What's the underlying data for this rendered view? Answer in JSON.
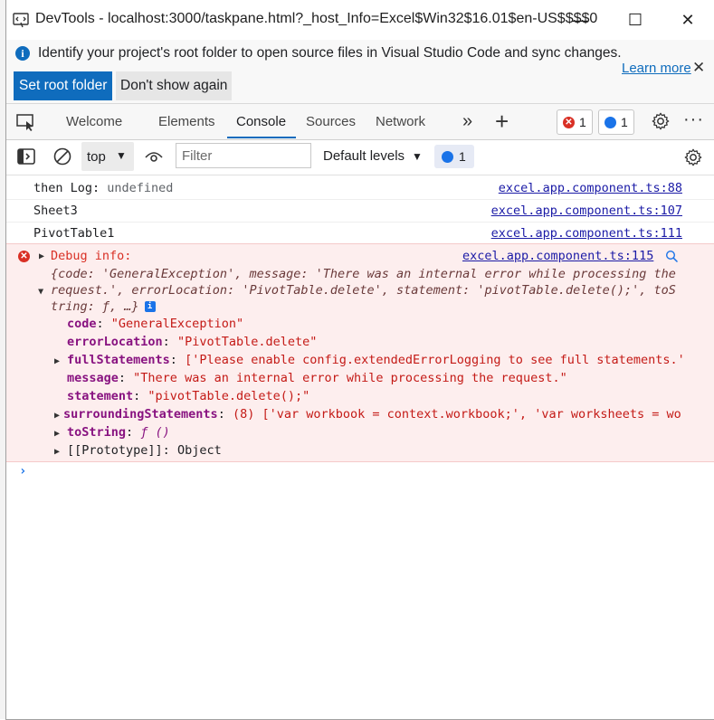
{
  "window": {
    "title": "DevTools - localhost:3000/taskpane.html?_host_Info=Excel$Win32$16.01$en-US$$$$0",
    "minimize": "—",
    "maximize": "☐",
    "close": "✕"
  },
  "infobar": {
    "message": "Identify your project's root folder to open source files in Visual Studio Code and sync changes.",
    "set_root_label": "Set root folder",
    "dont_show_label": "Don't show again",
    "learn_more_label": "Learn more",
    "close": "✕"
  },
  "tabs": {
    "items": [
      "Welcome",
      "Elements",
      "Console",
      "Sources",
      "Network"
    ],
    "active": "Console",
    "more": "»",
    "add": "+",
    "error_count": "1",
    "message_count": "1"
  },
  "console_toolbar": {
    "context": "top",
    "filter_placeholder": "Filter",
    "levels": "Default levels",
    "message_count": "1"
  },
  "logs": [
    {
      "prefix": "then Log: ",
      "value": "undefined",
      "source": "excel.app.component.ts:88"
    },
    {
      "prefix": "Sheet3",
      "value": "",
      "source": "excel.app.component.ts:107"
    },
    {
      "prefix": "PivotTable1",
      "value": "",
      "source": "excel.app.component.ts:111"
    }
  ],
  "error": {
    "title": "Debug info:",
    "source": "excel.app.component.ts:115",
    "summary_line1": "{code: 'GeneralException', message: 'There was an internal error while processing the",
    "summary_line2": "request.', errorLocation: 'PivotTable.delete', statement: 'pivotTable.delete();', toS",
    "summary_line3": "tring: ƒ, …}",
    "props": {
      "code_key": "code",
      "code_val": "\"GeneralException\"",
      "errorLocation_key": "errorLocation",
      "errorLocation_val": "\"PivotTable.delete\"",
      "fullStatements_key": "fullStatements",
      "fullStatements_val": "['Please enable config.extendedErrorLogging to see full statements.'",
      "message_key": "message",
      "message_val": "\"There was an internal error while processing the request.\"",
      "statement_key": "statement",
      "statement_val": "\"pivotTable.delete();\"",
      "surrounding_key": "surroundingStatements",
      "surrounding_val": "(8) ['var workbook = context.workbook;', 'var worksheets = wo",
      "toString_key": "toString",
      "toString_val": "ƒ ()",
      "prototype_key": "[[Prototype]]",
      "prototype_val": "Object"
    }
  },
  "prompt": "›",
  "colors": {
    "accent": "#0f6cbd",
    "error": "#d93025",
    "error_bg": "#fdeeee",
    "link": "#1a1aa6"
  }
}
